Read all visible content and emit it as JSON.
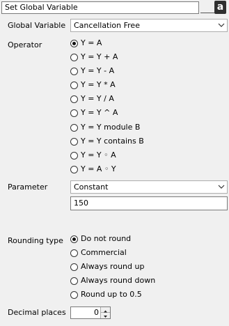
{
  "title_field": {
    "value": "Set Global Variable"
  },
  "a_button": {
    "label": "a"
  },
  "global_variable": {
    "label": "Global Variable",
    "selected": "Cancellation Free"
  },
  "operator": {
    "label": "Operator",
    "options": [
      {
        "label": "Y = A",
        "checked": true
      },
      {
        "label": "Y = Y + A",
        "checked": false
      },
      {
        "label": "Y = Y - A",
        "checked": false
      },
      {
        "label": "Y = Y * A",
        "checked": false
      },
      {
        "label": "Y = Y / A",
        "checked": false
      },
      {
        "label": "Y = Y ^ A",
        "checked": false
      },
      {
        "label": "Y = Y module B",
        "checked": false
      },
      {
        "label": "Y = Y contains B",
        "checked": false
      },
      {
        "label": "Y = Y ◦ A",
        "checked": false
      },
      {
        "label": "Y = A ◦ Y",
        "checked": false
      }
    ]
  },
  "parameter": {
    "label": "Parameter",
    "selected": "Constant",
    "value": "150"
  },
  "rounding": {
    "label": "Rounding type",
    "options": [
      {
        "label": "Do not round",
        "checked": true
      },
      {
        "label": "Commercial",
        "checked": false
      },
      {
        "label": "Always round up",
        "checked": false
      },
      {
        "label": "Always round down",
        "checked": false
      },
      {
        "label": "Round up to 0.5",
        "checked": false
      }
    ]
  },
  "decimal_places": {
    "label": "Decimal places",
    "value": "0"
  },
  "icons": {
    "dropdown": "chevron-down-icon",
    "spin_up": "arrow-up-icon",
    "spin_down": "arrow-down-icon"
  }
}
